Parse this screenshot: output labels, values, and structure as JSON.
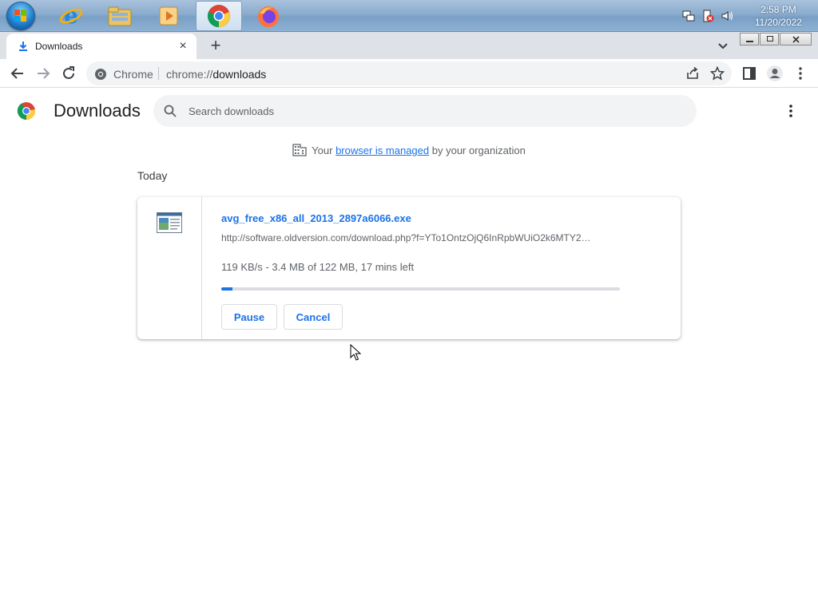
{
  "taskbar": {
    "apps": [
      {
        "name": "internet-explorer"
      },
      {
        "name": "file-explorer"
      },
      {
        "name": "media-player"
      },
      {
        "name": "chrome",
        "active": true
      },
      {
        "name": "firefox"
      }
    ],
    "clock": {
      "time": "2:58 PM",
      "date": "11/20/2022"
    }
  },
  "browser": {
    "tab": {
      "title": "Downloads",
      "close_glyph": "×"
    },
    "new_tab_glyph": "+",
    "omnibox": {
      "site_label": "Chrome",
      "url_scheme": "chrome://",
      "url_path": "downloads"
    }
  },
  "downloads": {
    "title": "Downloads",
    "search_placeholder": "Search downloads",
    "managed": {
      "prefix": "Your",
      "link": "browser is managed",
      "suffix": "by your organization"
    },
    "day_label": "Today",
    "items": [
      {
        "file_name": "avg_free_x86_all_2013_2897a6066.exe",
        "url": "http://software.oldversion.com/download.php?f=YTo1OntzOjQ6InRpbWUiO2k6MTY2…",
        "status": "119 KB/s - 3.4 MB of 122 MB, 17 mins left",
        "progress": 0.028,
        "pause_label": "Pause",
        "cancel_label": "Cancel"
      }
    ]
  },
  "colors": {
    "accent": "#1a73e8",
    "text": "#202124",
    "muted": "#5f6368"
  }
}
